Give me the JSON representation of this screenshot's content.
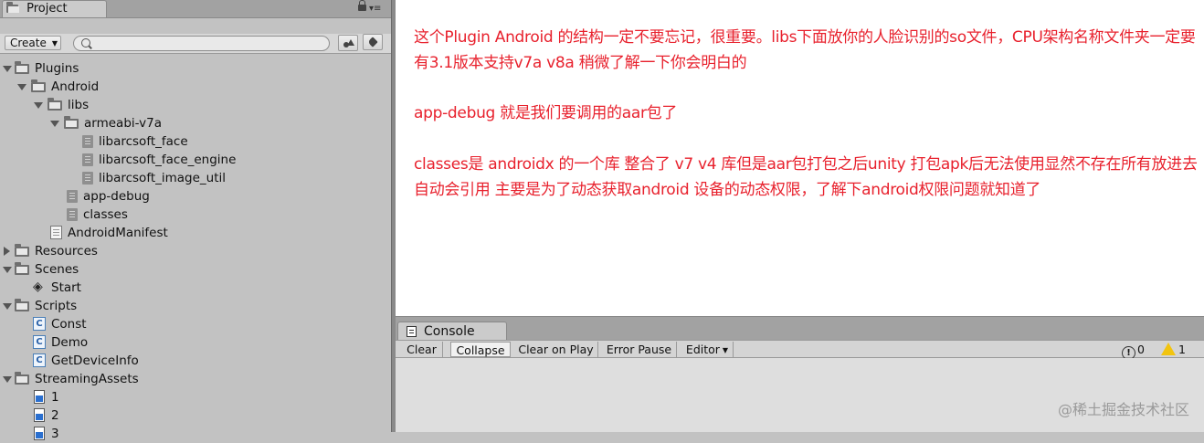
{
  "project": {
    "tab_label": "Project",
    "create_label": "Create",
    "search_placeholder": "",
    "tree": [
      {
        "label": "Plugins",
        "icon": "folder-icon",
        "expanded": true
      },
      {
        "label": "Android",
        "icon": "folder-icon",
        "expanded": true
      },
      {
        "label": "libs",
        "icon": "folder-icon",
        "expanded": true
      },
      {
        "label": "armeabi-v7a",
        "icon": "folder-icon",
        "expanded": true
      },
      {
        "label": "libarcsoft_face",
        "icon": "plugin-file-icon"
      },
      {
        "label": "libarcsoft_face_engine",
        "icon": "plugin-file-icon"
      },
      {
        "label": "libarcsoft_image_util",
        "icon": "plugin-file-icon"
      },
      {
        "label": "app-debug",
        "icon": "plugin-file-icon"
      },
      {
        "label": "classes",
        "icon": "plugin-file-icon"
      },
      {
        "label": "AndroidManifest",
        "icon": "text-file-icon"
      },
      {
        "label": "Resources",
        "icon": "folder-icon",
        "expanded": false
      },
      {
        "label": "Scenes",
        "icon": "folder-icon",
        "expanded": true
      },
      {
        "label": "Start",
        "icon": "unity-scene-icon"
      },
      {
        "label": "Scripts",
        "icon": "folder-icon",
        "expanded": true
      },
      {
        "label": "Const",
        "icon": "csharp-script-icon"
      },
      {
        "label": "Demo",
        "icon": "csharp-script-icon"
      },
      {
        "label": "GetDeviceInfo",
        "icon": "csharp-script-icon"
      },
      {
        "label": "StreamingAssets",
        "icon": "folder-icon",
        "expanded": true
      },
      {
        "label": "1",
        "icon": "image-file-icon"
      },
      {
        "label": "2",
        "icon": "image-file-icon"
      },
      {
        "label": "3",
        "icon": "image-file-icon"
      }
    ]
  },
  "article": {
    "color": "#e8212d",
    "paragraphs": [
      "这个Plugin  Android 的结构一定不要忘记，很重要。libs下面放你的人脸识别的so文件，CPU架构名称文件夹一定要有3.1版本支持v7a  v8a 稍微了解一下你会明白的",
      "app-debug 就是我们要调用的aar包了",
      "classes是 androidx 的一个库 整合了  v7 v4 库但是aar包打包之后unity 打包apk后无法使用显然不存在所有放进去自动会引用 主要是为了动态获取android 设备的动态权限，了解下android权限问题就知道了"
    ]
  },
  "console": {
    "tab_label": "Console",
    "buttons": {
      "clear": "Clear",
      "collapse": "Collapse",
      "clear_on_play": "Clear on Play",
      "error_pause": "Error Pause",
      "editor": "Editor"
    },
    "info_count": "0",
    "warning_count": "1"
  },
  "watermark": "@稀土掘金技术社区"
}
